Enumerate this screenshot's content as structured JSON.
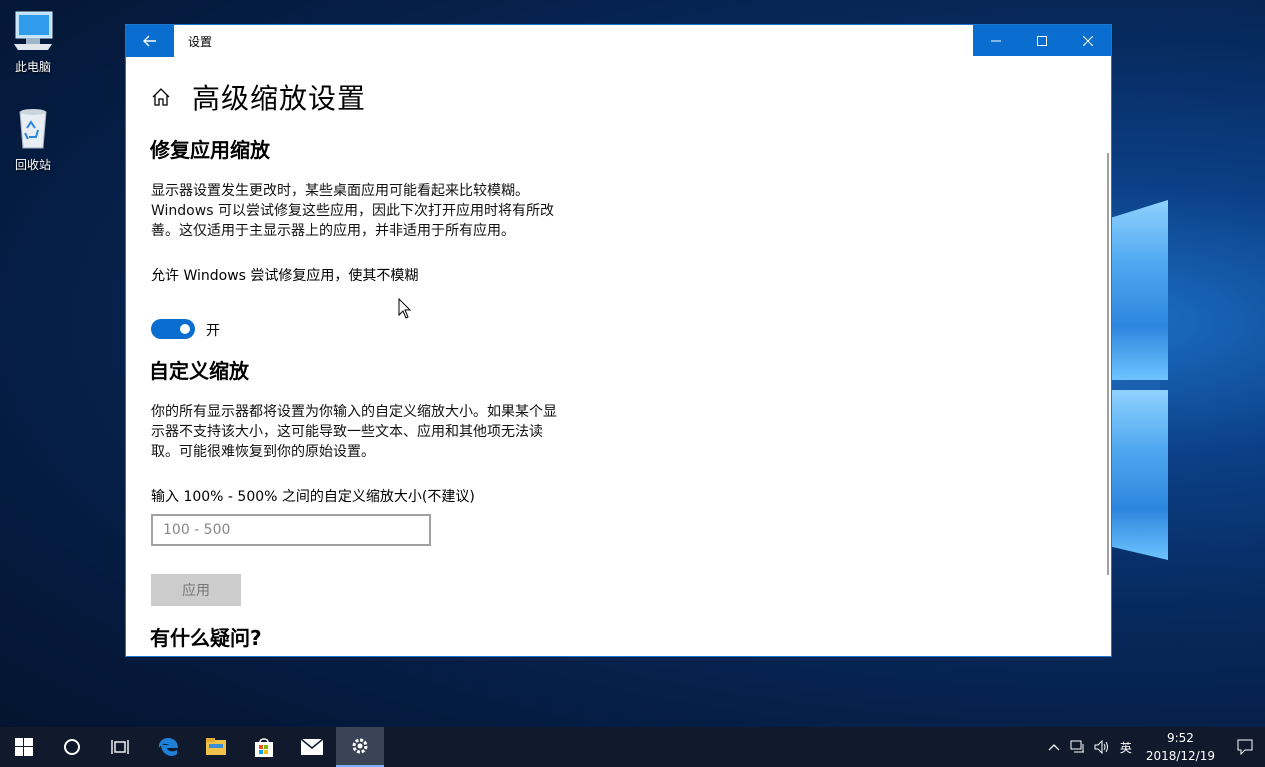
{
  "desktop": {
    "icons": [
      {
        "label": "此电脑",
        "icon": "computer-icon"
      },
      {
        "label": "回收站",
        "icon": "recycle-bin-icon"
      }
    ]
  },
  "window": {
    "title": "设置",
    "back_icon": "back-arrow-icon",
    "controls": [
      "minimize-icon",
      "maximize-icon",
      "close-icon"
    ],
    "accent_color": "#0a6ed1"
  },
  "page": {
    "title": "高级缩放设置",
    "home_icon": "home-icon"
  },
  "fix_scaling": {
    "heading": "修复应用缩放",
    "description_lines": [
      "显示器设置发生更改时，某些桌面应用可能看起来比较模糊。",
      "Windows 可以尝试修复这些应用，因此下次打开应用时将有所改",
      "善。这仅适用于主显示器上的应用，并非适用于所有应用。"
    ],
    "toggle_label": "允许 Windows 尝试修复应用，使其不模糊",
    "toggle_state": "开",
    "toggle_on": true
  },
  "custom_scaling": {
    "heading": "自定义缩放",
    "description_lines": [
      "你的所有显示器都将设置为你输入的自定义缩放大小。如果某个显",
      "示器不支持该大小，这可能导致一些文本、应用和其他项无法读",
      "取。可能很难恢复到你的原始设置。"
    ],
    "input_label": "输入 100% - 500% 之间的自定义缩放大小(不建议)",
    "input_placeholder": "100 - 500",
    "apply_label": "应用"
  },
  "questions": {
    "heading": "有什么疑问?"
  },
  "taskbar": {
    "items": [
      "windows-start-icon",
      "cortana-search-icon",
      "task-view-icon",
      "edge-browser-icon",
      "file-explorer-icon",
      "store-icon",
      "mail-icon",
      "settings-gear-icon"
    ],
    "active_item": "settings-gear-icon",
    "tray": {
      "language": "英",
      "time": "9:52",
      "date": "2018/12/19"
    }
  }
}
